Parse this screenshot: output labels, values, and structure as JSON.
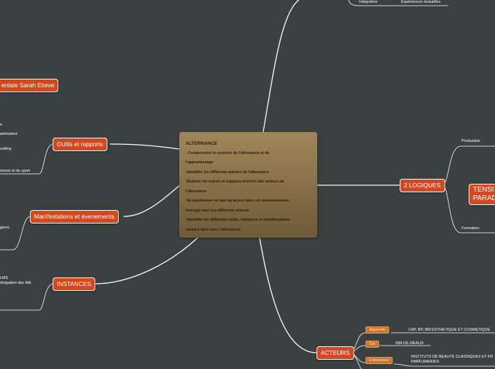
{
  "central": {
    "title": "ALTERNANCE",
    "lines": [
      "- Comprrendre  le système de l'alternance et de",
      "l'apprentissage",
      "-Identifier les différents acteurs de l'alternance",
      "-Repérer les enjeux et logiques d'action des acteurs de",
      "l'alternance",
      "-Se positionner en tant qu'acteur dans cet  environnement,",
      "interagir avec les différents acteurs",
      "-Identifier les différents outils, instances et manifestations",
      "visant à faire vivre l'alternance"
    ]
  },
  "branches": {
    "sarah": "entale Sarah Etieve",
    "outils": "Outils et rapports",
    "manif": "Manifestations et évenements",
    "instances": "INSTANCES",
    "logiques": "2 LOGIQUES",
    "tension": [
      "TENSI",
      "PARAD"
    ],
    "acteurs": "ACTEURS"
  },
  "leaves": {
    "top_integrative": "Intégrative",
    "top_experiences": "Expériences mutuelles",
    "outils_1": "e",
    "outils_2": "artenaires",
    "outils_3": "sulting",
    "outils_4": "nesse et du sport",
    "manif_1": "giens",
    "inst_1": "LMS",
    "inst_2": "rticipation des MA",
    "production": "Production",
    "formation": "Formation",
    "act_apprentis_value": "CAP, BP, BM ESTHETIQUE ET COSMETIQUE",
    "act_cfa_value": "IMA DE MEAUX",
    "act_entreprises_value_1": "INSTITUTS DE BEAUTE CLASSIQUES ET FR",
    "act_entreprises_value_2": "PARFUMERIES"
  },
  "tags": {
    "apprentis": "Apprentis",
    "cfa": "Cfa",
    "entreprises": "Entreprises"
  },
  "colors": {
    "background": "#3b4040",
    "node": "#cf4a22",
    "tag": "#c8752f",
    "central_top": "#a0875a",
    "central_bottom": "#6f5a38",
    "link": "#ffffff"
  }
}
